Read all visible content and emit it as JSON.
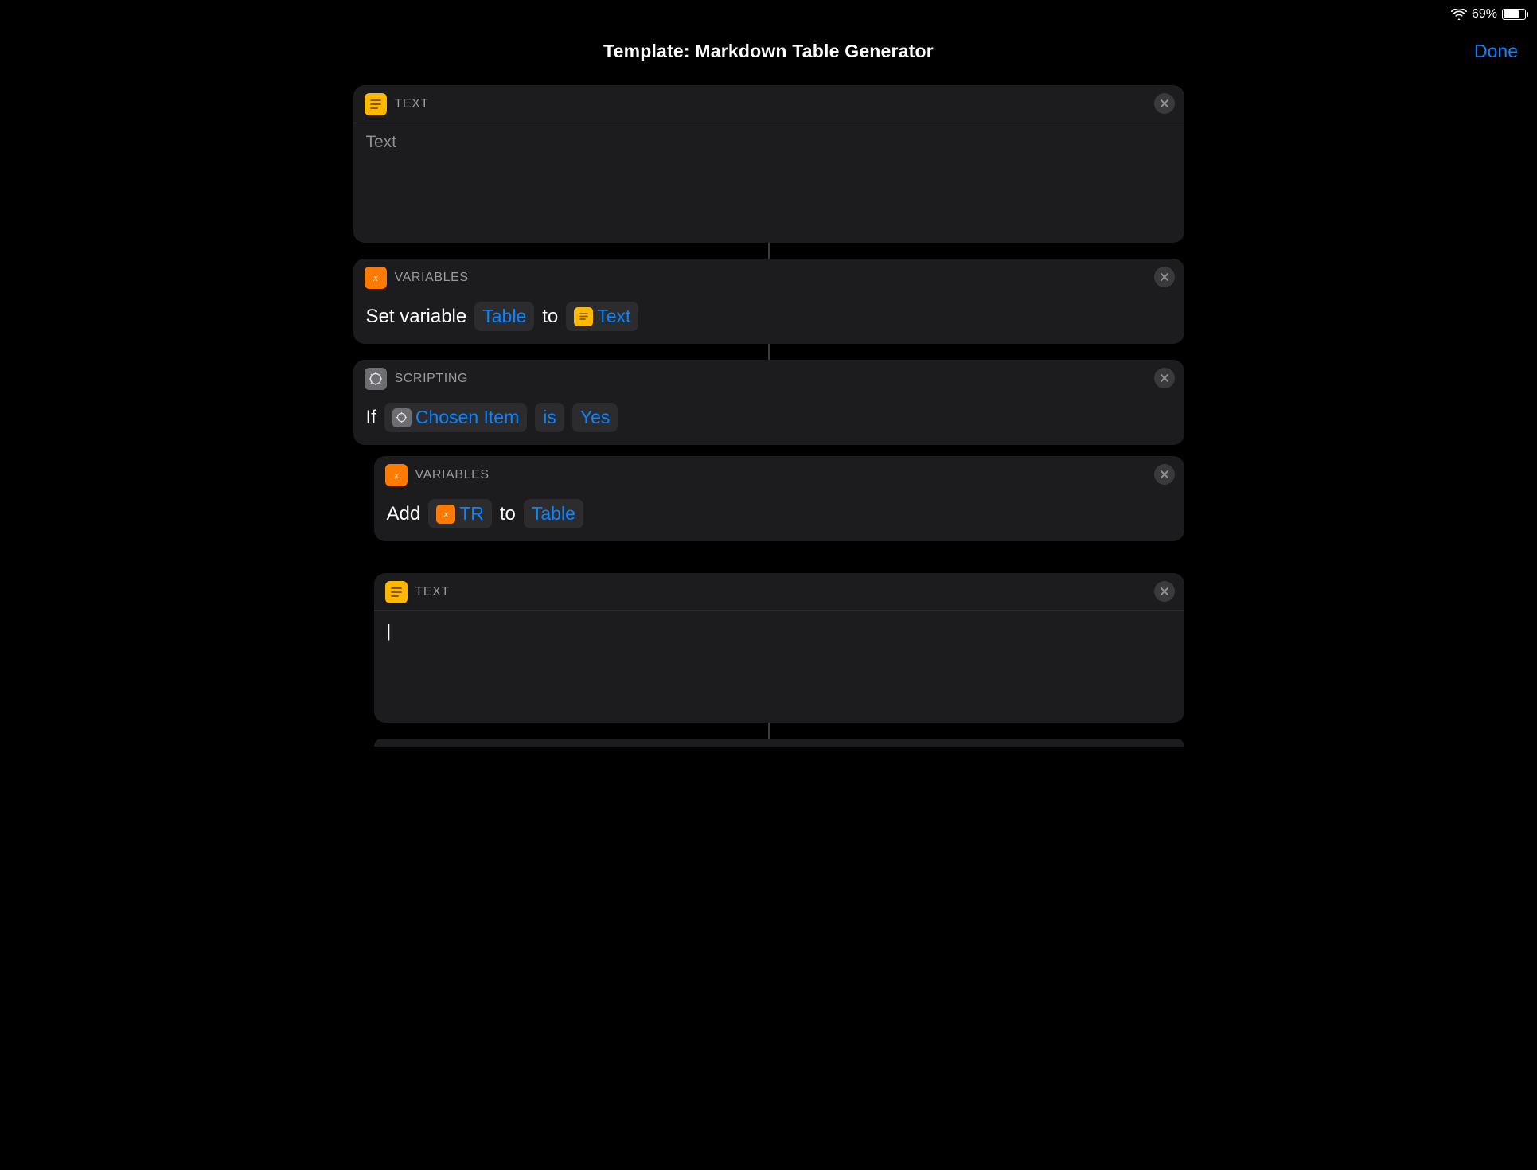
{
  "status": {
    "battery_text": "69%",
    "battery_fill_pct": 69
  },
  "header": {
    "title": "Template: Markdown Table Generator",
    "done": "Done"
  },
  "actions": {
    "text1": {
      "category": "TEXT",
      "placeholder": "Text"
    },
    "setvar": {
      "category": "VARIABLES",
      "prefix": "Set variable",
      "var_name": "Table",
      "mid": "to",
      "value_label": "Text"
    },
    "ifblock": {
      "category": "SCRIPTING",
      "prefix": "If",
      "input_label": "Chosen Item",
      "op": "is",
      "value": "Yes"
    },
    "addvar": {
      "category": "VARIABLES",
      "prefix": "Add",
      "value_label": "TR",
      "mid": "to",
      "var_name": "Table"
    },
    "text2": {
      "category": "TEXT",
      "content": "|"
    }
  }
}
